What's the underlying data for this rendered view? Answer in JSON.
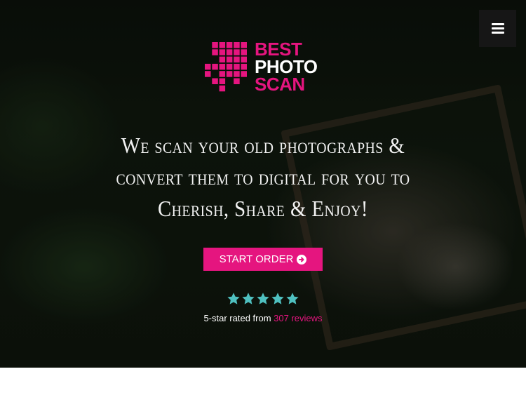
{
  "logo": {
    "line1": "BEST",
    "line2": "PHOTO",
    "line3": "SCAN"
  },
  "hero": {
    "headline_line1": "We scan your old photographs &",
    "headline_line2": "convert them to digital for you to",
    "headline_line3": "Cherish, Share & Enjoy!",
    "cta_label": "START ORDER",
    "rating_stars": 5,
    "rating_text": "5-star rated from ",
    "reviews_link": "307 reviews"
  },
  "icons": {
    "menu": "hamburger-menu-icon",
    "cta_arrow": "arrow-circle-right-icon",
    "star": "star-icon"
  },
  "colors": {
    "brand_pink": "#e5157f",
    "star_teal": "#4fc0c0",
    "menu_bg": "#161616"
  }
}
